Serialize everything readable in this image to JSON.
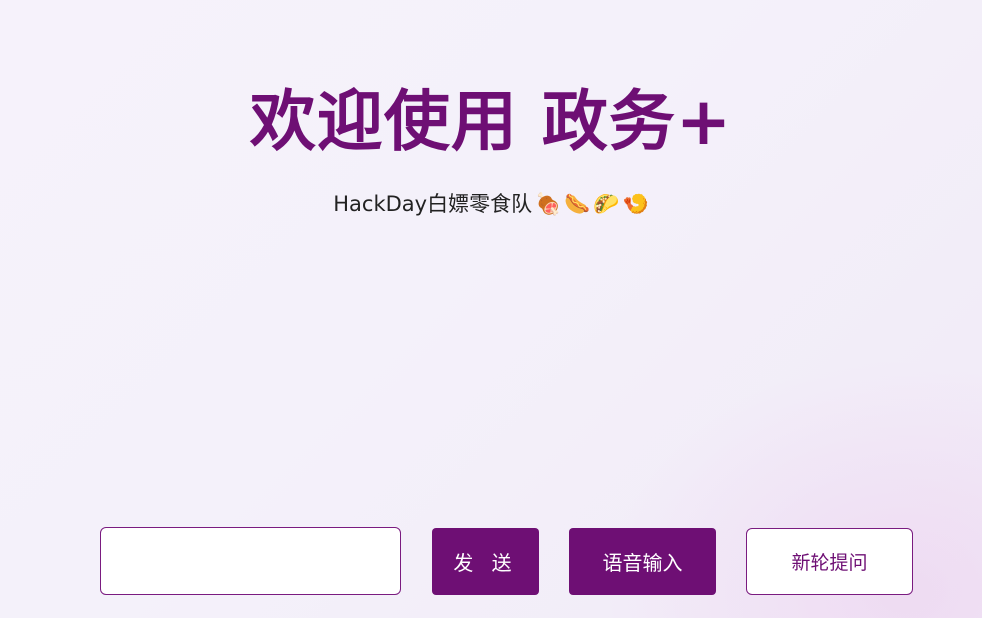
{
  "hero": {
    "title": "欢迎使用 政务+",
    "subtitle": "HackDay白嫖零食队",
    "emojis": [
      "🍖",
      "🌭",
      "🌮",
      "🍤"
    ]
  },
  "chat": {
    "input_value": "",
    "send_label": "发 送",
    "voice_label": "语音输入",
    "new_round_label": "新轮提问"
  },
  "colors": {
    "brand": "#6e0f74",
    "background": "#f4f1fa",
    "text": "#222222"
  }
}
